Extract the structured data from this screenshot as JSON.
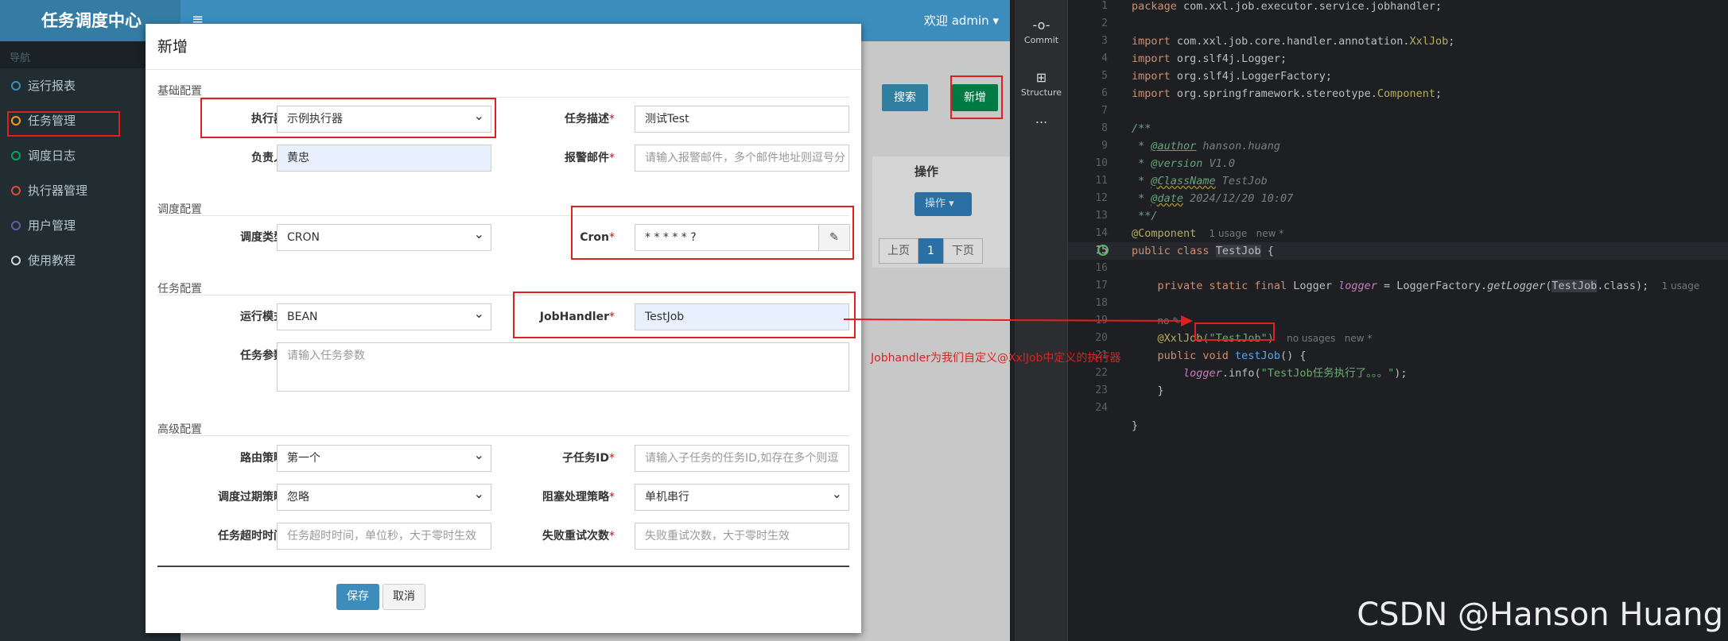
{
  "admin": {
    "app_title": "任务调度中心",
    "menu_toggle": "≡",
    "welcome": "欢迎 admin ▾",
    "nav_header": "导航",
    "nav": [
      {
        "label": "运行报表",
        "color": "#3c8dbc"
      },
      {
        "label": "任务管理",
        "color": "#f39c12"
      },
      {
        "label": "调度日志",
        "color": "#00a65a"
      },
      {
        "label": "执行器管理",
        "color": "#dd4b39"
      },
      {
        "label": "用户管理",
        "color": "#605ca8"
      },
      {
        "label": "使用教程",
        "color": "#d2d6de"
      }
    ],
    "search_button": "搜索",
    "add_button": "新增",
    "table_op_header": "操作",
    "op_button": "操作",
    "pager": {
      "prev": "上页",
      "current": "1",
      "next": "下页"
    }
  },
  "modal": {
    "title": "新增",
    "sections": {
      "basic": "基础配置",
      "schedule": "调度配置",
      "task": "任务配置",
      "advanced": "高级配置"
    },
    "fields": {
      "executor": {
        "label": "执行器",
        "value": "示例执行器"
      },
      "job_desc": {
        "label": "任务描述",
        "value": "测试Test"
      },
      "author": {
        "label": "负责人",
        "value": "黄忠"
      },
      "alarm_email": {
        "label": "报警邮件",
        "placeholder": "请输入报警邮件，多个邮件地址则逗号分"
      },
      "schedule_type": {
        "label": "调度类型",
        "value": "CRON"
      },
      "cron": {
        "label": "Cron",
        "value": "* * * * * ?"
      },
      "run_mode": {
        "label": "运行模式",
        "value": "BEAN"
      },
      "job_handler": {
        "label": "JobHandler",
        "value": "TestJob"
      },
      "job_param": {
        "label": "任务参数",
        "placeholder": "请输入任务参数"
      },
      "route_strategy": {
        "label": "路由策略",
        "value": "第一个"
      },
      "child_job_id": {
        "label": "子任务ID",
        "placeholder": "请输入子任务的任务ID,如存在多个则逗"
      },
      "misfire_strategy": {
        "label": "调度过期策略",
        "value": "忽略"
      },
      "block_strategy": {
        "label": "阻塞处理策略",
        "value": "单机串行"
      },
      "timeout": {
        "label": "任务超时时间",
        "placeholder": "任务超时时间，单位秒，大于零时生效"
      },
      "fail_retry": {
        "label": "失败重试次数",
        "placeholder": "失败重试次数，大于零时生效"
      }
    },
    "save_button": "保存",
    "cancel_button": "取消"
  },
  "ide": {
    "tools": [
      {
        "icon": "commit-icon",
        "label": "Commit"
      },
      {
        "icon": "structure-icon",
        "label": "Structure"
      },
      {
        "icon": "more-icon",
        "label": "..."
      }
    ],
    "line_numbers": [
      "1",
      "2",
      "3",
      "4",
      "5",
      "6",
      "7",
      "8",
      "9",
      "10",
      "11",
      "12",
      "13",
      "14",
      "15",
      "16",
      "17",
      "18",
      "19",
      "20",
      "21",
      "22",
      "23",
      "24"
    ],
    "code": {
      "l1_kw": "package",
      "l1": " com.xxl.job.executor.service.jobhandler;",
      "l3_kw": "import",
      "l3": " com.xxl.job.core.handler.annotation.",
      "l3_an": "XxlJob",
      "l3_end": ";",
      "l4_kw": "import",
      "l4": " org.slf4j.Logger;",
      "l5_kw": "import",
      "l5": " org.slf4j.LoggerFactory;",
      "l6_kw": "import",
      "l6": " org.springframework.stereotype.",
      "l6_an": "Component",
      "l6_end": ";",
      "l8": "/**",
      "l9_a": " * ",
      "l9_tag": "@author",
      "l9_b": " hanson.huang",
      "l10_a": " * ",
      "l10_tag": "@version",
      "l10_b": " V1.0",
      "l11_a": " * ",
      "l11_tag": "@ClassName",
      "l11_b": " TestJob",
      "l12_a": " * ",
      "l12_tag": "@date",
      "l12_b": " 2024/12/20 10:07",
      "l13": " **/",
      "l14_an": "@Component",
      "l14_hint": "1 usage   new *",
      "l15_kw": "public class",
      "l15_cls": "TestJob",
      "l15_end": " {",
      "l17_kw": "private static final",
      "l17_a": " Logger ",
      "l17_fd": "logger",
      "l17_b": " = LoggerFactory.",
      "l17_m": "getLogger",
      "l17_c": "(",
      "l17_cls": "TestJob",
      "l17_d": ".class);",
      "l17_hint": "1 usage",
      "l18_hint": "no ✎",
      "l19_an": "@XxlJob",
      "l19_st": "(\"TestJob\")",
      "l19_hint": "no usages   new *",
      "l20_kw": "public void",
      "l20_fn": " testJob",
      "l20_end": "() {",
      "l21_fd": "logger",
      "l21_a": ".info(",
      "l21_st": "\"TestJob任务执行了。。。\"",
      "l21_end": ");",
      "l22": "}",
      "l24": "}"
    }
  },
  "annotation": "Jobhandler为我们自定义@XxlJob中定义的执行器",
  "watermark": "CSDN @Hanson Huang",
  "colors": {
    "highlight": "#e02020",
    "sidebar": "#222d32",
    "topbar": "#3c8dbc",
    "logo": "#357ca5",
    "add_button": "#00a65a"
  }
}
